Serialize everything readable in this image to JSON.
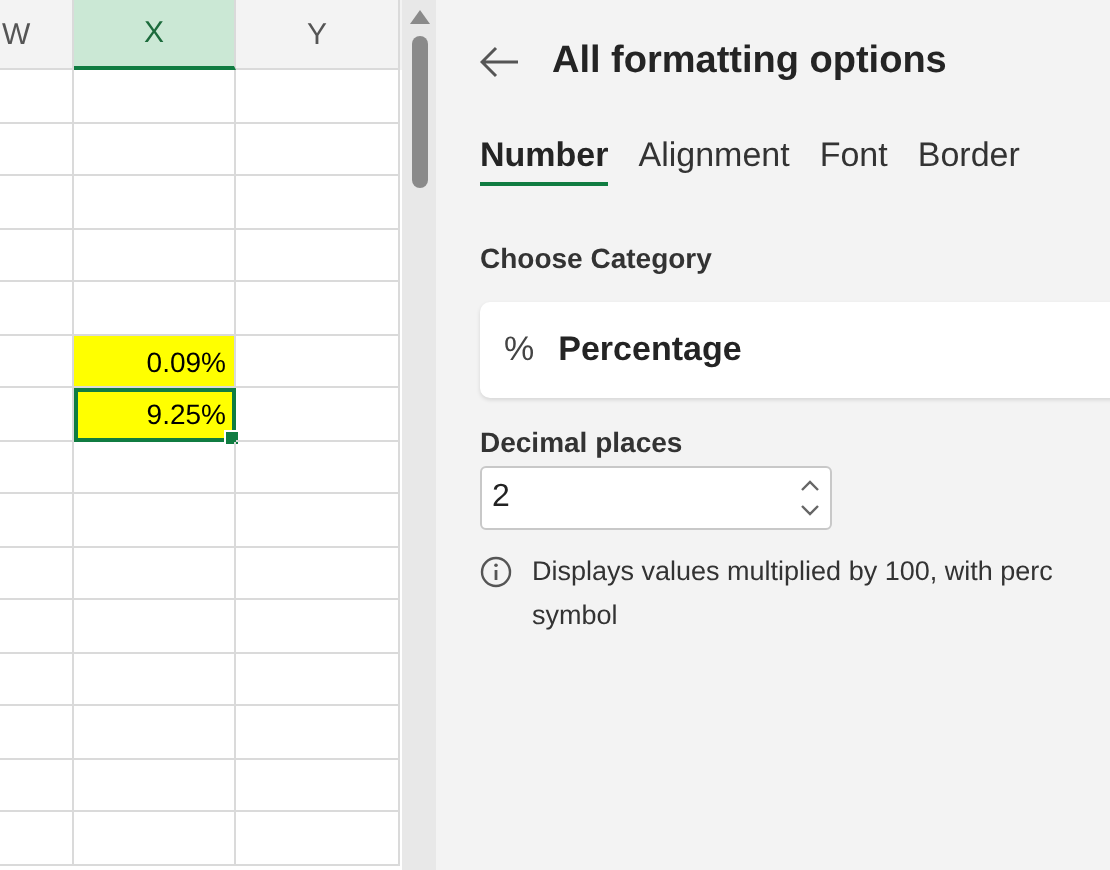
{
  "sheet": {
    "columns": [
      {
        "header": "W",
        "selected": false
      },
      {
        "header": "X",
        "selected": true,
        "cells": [
          {
            "text": "0.09%",
            "highlighted": true,
            "selected": false
          },
          {
            "text": "9.25%",
            "highlighted": true,
            "selected": true
          }
        ]
      },
      {
        "header": "Y",
        "selected": false
      }
    ]
  },
  "panel": {
    "title": "All formatting options",
    "tabs": [
      {
        "label": "Number",
        "selected": true
      },
      {
        "label": "Alignment",
        "selected": false
      },
      {
        "label": "Font",
        "selected": false
      },
      {
        "label": "Border",
        "selected": false
      }
    ],
    "category_label": "Choose Category",
    "category": {
      "icon": "%",
      "label": "Percentage"
    },
    "decimal_places": {
      "label": "Decimal places",
      "value": "2"
    },
    "description_lines": [
      "Displays values multiplied by 100, with perc",
      "symbol"
    ]
  }
}
